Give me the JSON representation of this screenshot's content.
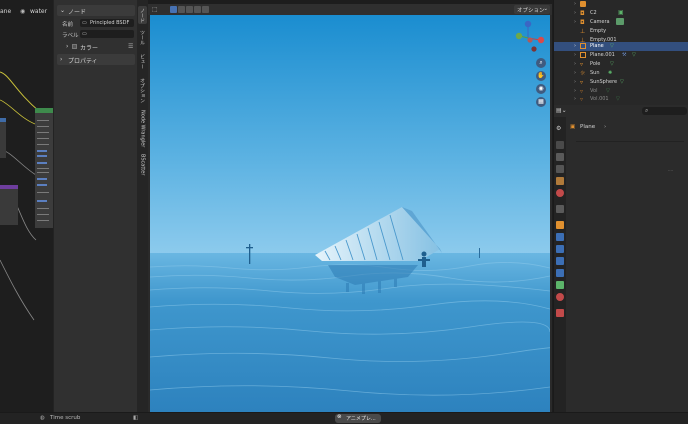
{
  "node_editor": {
    "header_left_label": "ane",
    "header_material": "water"
  },
  "node_sidebar": {
    "node_panel_title": "ノード",
    "name_label": "名前",
    "name_value": "Principled BSDF",
    "label_label": "ラベル",
    "label_value": "",
    "color_label": "カラー",
    "properties_title": "プロパティ"
  },
  "vtabs": [
    "ノード",
    "ツール",
    "ビュー",
    "オプション",
    "Node Wrangler",
    "BScatter"
  ],
  "viewport": {
    "options_label": "オプション"
  },
  "outliner": {
    "items": [
      {
        "name": "",
        "icon": "object-icon",
        "color": "#e0902f"
      },
      {
        "name": "C2",
        "icon": "camera-icon",
        "color": "#e0902f"
      },
      {
        "name": "Camera",
        "icon": "camera-icon",
        "color": "#e0902f"
      },
      {
        "name": "Empty",
        "icon": "empty-icon",
        "color": "#e0902f"
      },
      {
        "name": "Empty.001",
        "icon": "empty-icon",
        "color": "#e0902f"
      },
      {
        "name": "Plane",
        "icon": "mesh-icon",
        "color": "#e0902f",
        "selected": true
      },
      {
        "name": "Plane.001",
        "icon": "mesh-icon",
        "color": "#e0902f"
      },
      {
        "name": "Pole",
        "icon": "mesh-icon",
        "color": "#e0902f"
      },
      {
        "name": "Sun",
        "icon": "light-icon",
        "color": "#e0902f"
      },
      {
        "name": "SunSphere",
        "icon": "mesh-icon",
        "color": "#e0902f"
      },
      {
        "name": "Vol",
        "icon": "mesh-icon",
        "color": "#e0902f"
      },
      {
        "name": "Vol.001",
        "icon": "mesh-icon",
        "color": "#e0902f"
      }
    ]
  },
  "properties": {
    "breadcrumb_object": "Plane"
  },
  "statusbar": {
    "left_action": "Time scrub",
    "center_job": "アニメプレ..."
  },
  "colors": {
    "selection": "#334f7e",
    "accent_blue": "#4772b3",
    "sky_top": "#1e8fd0",
    "sea": "#3b8fc8"
  }
}
